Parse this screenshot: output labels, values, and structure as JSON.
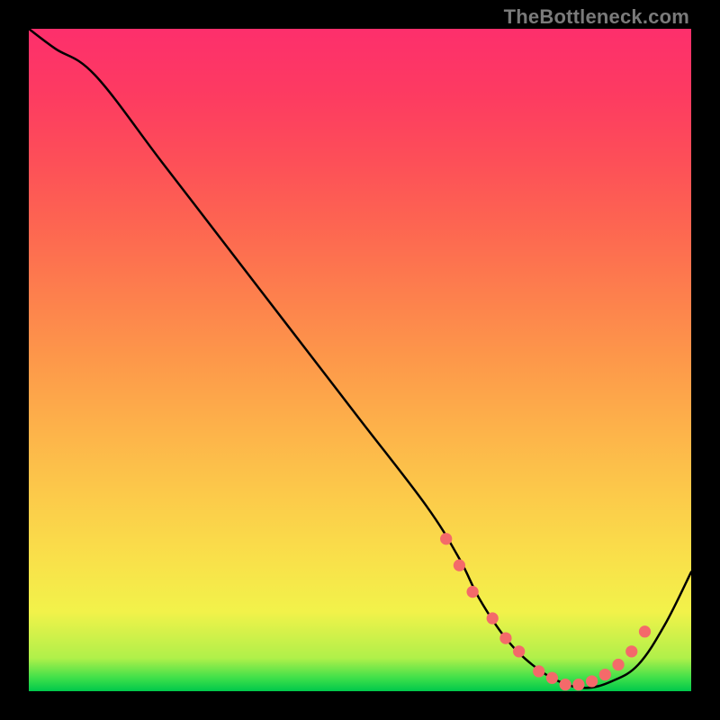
{
  "watermark": "TheBottleneck.com",
  "chart_data": {
    "type": "line",
    "title": "",
    "xlabel": "",
    "ylabel": "",
    "xlim": [
      0,
      100
    ],
    "ylim": [
      0,
      100
    ],
    "grid": false,
    "legend": false,
    "annotations": [],
    "series": [
      {
        "name": "curve",
        "color": "#000000",
        "x": [
          0,
          4,
          10,
          20,
          30,
          40,
          50,
          60,
          65,
          68,
          72,
          76,
          80,
          84,
          88,
          92,
          96,
          100
        ],
        "values": [
          100,
          97,
          93,
          80,
          67,
          54,
          41,
          28,
          20,
          14,
          8,
          4,
          1.5,
          0.5,
          1.5,
          4,
          10,
          18
        ]
      }
    ],
    "markers": {
      "name": "dots",
      "color": "#f46a6a",
      "radius_pct": 0.9,
      "x": [
        63,
        65,
        67,
        70,
        72,
        74,
        77,
        79,
        81,
        83,
        85,
        87,
        89,
        91,
        93
      ],
      "values": [
        23,
        19,
        15,
        11,
        8,
        6,
        3,
        2,
        1,
        1,
        1.5,
        2.5,
        4,
        6,
        9
      ]
    }
  }
}
